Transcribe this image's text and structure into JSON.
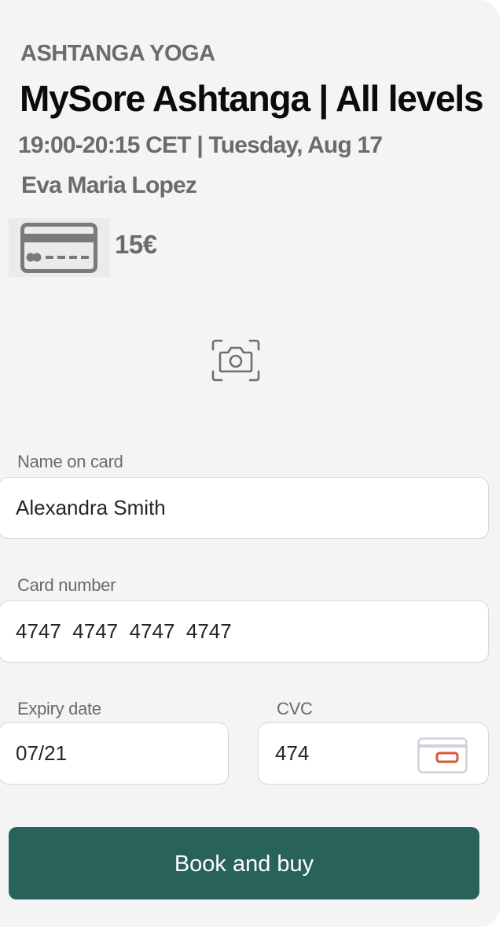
{
  "class_info": {
    "category": "ASHTANGA YOGA",
    "title": "MySore Ashtanga | All levels",
    "time": "19:00-20:15 CET | Tuesday, Aug 17",
    "teacher": "Eva Maria Lopez",
    "price": "15€",
    "price_icon": "credit-card-icon"
  },
  "scan_card": {
    "icon": "camera-scan-icon"
  },
  "form": {
    "name_label": "Name on card",
    "name_value": "Alexandra Smith",
    "card_number_label": "Card number",
    "card_number_value": "4747  4747  4747  4747",
    "expiry_label": "Expiry date",
    "expiry_value": "07/21",
    "cvc_label": "CVC",
    "cvc_value": "474",
    "cvc_icon": "card-back-cvc-icon"
  },
  "actions": {
    "book_label": "Book and buy"
  },
  "colors": {
    "background": "#f4f4f5",
    "primary_button": "#29625b",
    "cvc_accent": "#d9553a",
    "muted_text": "#6b6b6b"
  }
}
